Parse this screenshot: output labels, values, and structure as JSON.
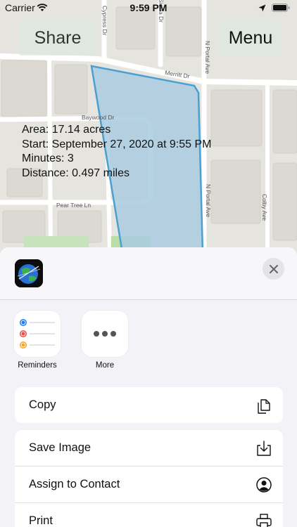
{
  "status_bar": {
    "carrier": "Carrier",
    "time": "9:59 PM"
  },
  "map": {
    "street_labels": {
      "cypress": "Cypress Dr",
      "sierra": "Sierra Dr",
      "portal_top": "N Portal Ave",
      "merritt": "Merritt Dr",
      "baywood": "Baywood Dr",
      "portal_bottom": "N Portal Ave",
      "colby": "Colby Ave",
      "pear_tree": "Pear Tree Ln"
    },
    "area_fill": "#a9cbe0",
    "area_stroke": "#4a9fd3"
  },
  "buttons": {
    "share": "Share",
    "menu": "Menu"
  },
  "info": {
    "area": "Area: 17.14 acres",
    "start": "Start: September 27, 2020 at 9:55 PM",
    "minutes": "Minutes: 3",
    "distance": "Distance: 0.497 miles"
  },
  "share_sheet": {
    "apps": [
      {
        "label": "Reminders",
        "icon": "reminders-icon"
      },
      {
        "label": "More",
        "icon": "more-icon"
      }
    ],
    "actions_group1": [
      {
        "label": "Copy",
        "icon": "copy-icon"
      }
    ],
    "actions_group2": [
      {
        "label": "Save Image",
        "icon": "save-image-icon"
      },
      {
        "label": "Assign to Contact",
        "icon": "contact-icon"
      },
      {
        "label": "Print",
        "icon": "print-icon"
      }
    ]
  }
}
